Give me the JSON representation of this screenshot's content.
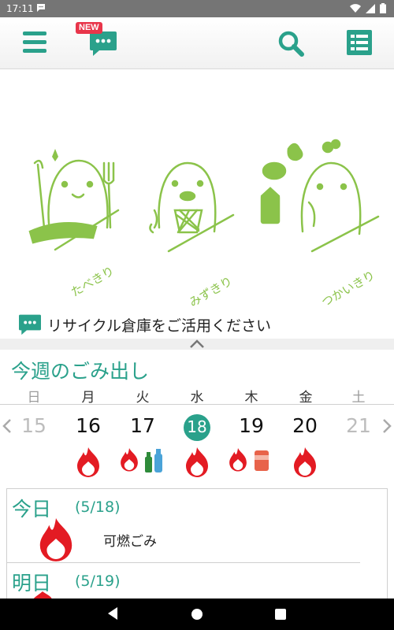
{
  "status_bar": {
    "time": "17:11"
  },
  "toolbar": {
    "new_badge": "NEW"
  },
  "banner": {
    "caption": "リサイクル倉庫をご活用ください",
    "labels": [
      "たべきり",
      "みずきり",
      "つかいきり"
    ]
  },
  "week": {
    "title": "今週のごみ出し",
    "days": [
      {
        "dow": "日",
        "date": "15"
      },
      {
        "dow": "月",
        "date": "16"
      },
      {
        "dow": "火",
        "date": "17"
      },
      {
        "dow": "水",
        "date": "18"
      },
      {
        "dow": "木",
        "date": "19"
      },
      {
        "dow": "金",
        "date": "20"
      },
      {
        "dow": "土",
        "date": "21"
      }
    ]
  },
  "today": {
    "label": "今日",
    "date": "(5/18)",
    "item": "可燃ごみ"
  },
  "tomorrow": {
    "label": "明日",
    "date": "(5/19)"
  },
  "colors": {
    "accent": "#2aa18b",
    "mascot": "#8bc34a",
    "fire": "#e31b23"
  }
}
